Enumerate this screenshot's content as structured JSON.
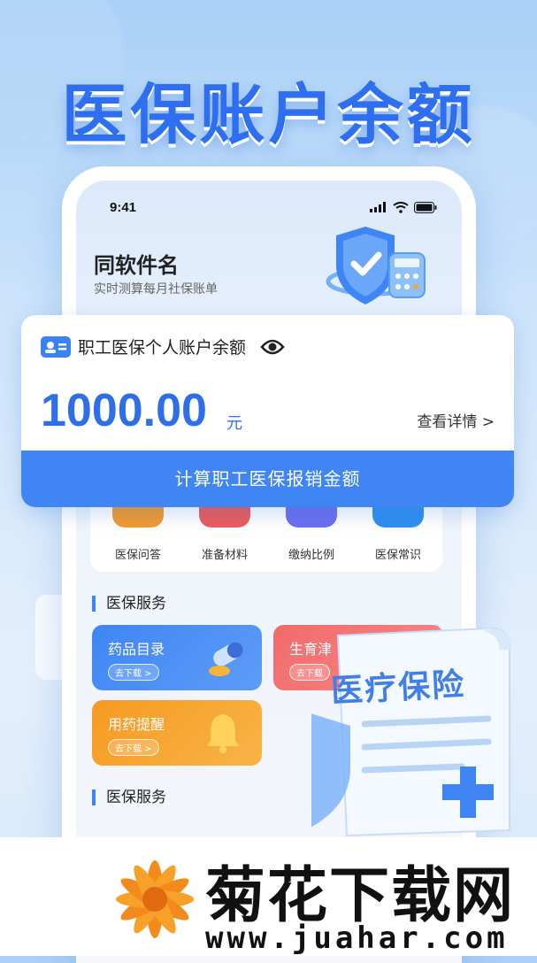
{
  "hero": {
    "title": "医保账户余额"
  },
  "phone": {
    "status": {
      "time": "9:41"
    },
    "app": {
      "name": "同软件名",
      "subtitle": "实时测算每月社保账单"
    }
  },
  "balance_card": {
    "title": "职工医保个人账户余额",
    "amount": "1000.00",
    "currency": "元",
    "detail_link": "查看详情 >",
    "calc_button": "计算职工医保报销金额"
  },
  "shortcuts": [
    {
      "label": "医保问答",
      "color": "#f39a2c"
    },
    {
      "label": "准备材料",
      "color": "#ee5a5a"
    },
    {
      "label": "缴纳比例",
      "color": "#6c6ef0"
    },
    {
      "label": "医保常识",
      "color": "#2f8ff0"
    }
  ],
  "sections": [
    {
      "title": "医保服务"
    },
    {
      "title": "医保服务"
    }
  ],
  "services": [
    {
      "name": "药品目录",
      "button": "去下载 >",
      "color": "#3f86f4"
    },
    {
      "name": "生育津",
      "button": "去下载",
      "color": "#f26a6a"
    },
    {
      "name": "用药提醒",
      "button": "去下载 >",
      "color": "#f7a22a"
    }
  ],
  "document": {
    "title": "医疗保险"
  },
  "watermark": {
    "name": "菊花下载网",
    "url": "www.juahar.com"
  },
  "colors": {
    "accent": "#2e6ee8",
    "button": "#3f86f4"
  }
}
